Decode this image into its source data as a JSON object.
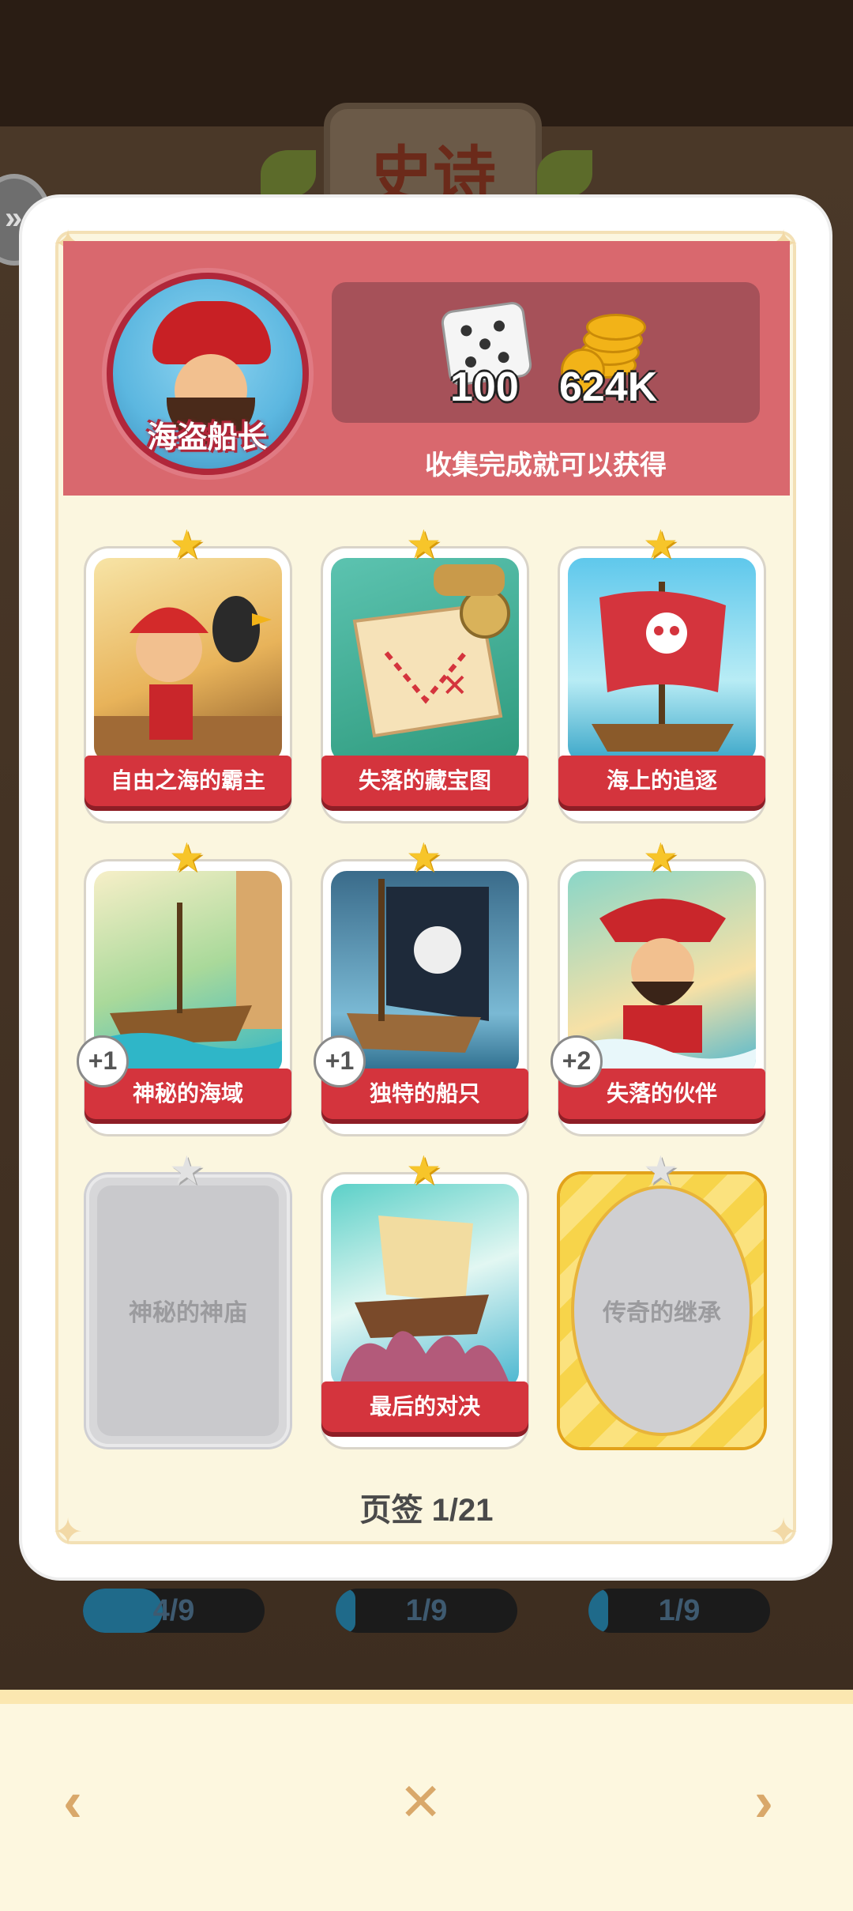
{
  "background": {
    "plaque_text": "史诗",
    "progress": [
      {
        "label": "4/9",
        "fraction": 0.44
      },
      {
        "label": "1/9",
        "fraction": 0.11
      },
      {
        "label": "1/9",
        "fraction": 0.11
      }
    ]
  },
  "header": {
    "avatar_name": "海盗船长",
    "rewards": [
      {
        "icon": "dice-icon",
        "value": "100"
      },
      {
        "icon": "coins-icon",
        "value": "624K"
      }
    ],
    "note": "收集完成就可以获得"
  },
  "cards": [
    {
      "title": "自由之海的霸主",
      "state": "owned",
      "star": "gold",
      "art": "pirate-with-parrot"
    },
    {
      "title": "失落的藏宝图",
      "state": "owned",
      "star": "gold",
      "art": "treasure-map"
    },
    {
      "title": "海上的追逐",
      "state": "owned",
      "star": "gold",
      "art": "pirate-ship-flag"
    },
    {
      "title": "神秘的海域",
      "state": "owned",
      "star": "gold",
      "badge": "+1",
      "art": "boat-cliffs"
    },
    {
      "title": "独特的船只",
      "state": "owned",
      "star": "gold",
      "badge": "+1",
      "art": "black-sail-ship"
    },
    {
      "title": "失落的伙伴",
      "state": "owned",
      "star": "gold",
      "badge": "+2",
      "art": "pirate-captain-waves"
    },
    {
      "title": "神秘的神庙",
      "state": "locked",
      "star": "grey"
    },
    {
      "title": "最后的对决",
      "state": "owned",
      "star": "gold",
      "art": "kraken-ship"
    },
    {
      "title": "传奇的继承",
      "state": "legendary-locked",
      "star": "grey"
    }
  ],
  "pager": "页签 1/21",
  "nav": {
    "prev": "‹",
    "close": "✕",
    "next": "›"
  },
  "colors": {
    "header_bg": "#d9686e",
    "card_label": "#d4343d",
    "star_gold": "#f7c52a",
    "nav_accent": "#d9a86a"
  }
}
